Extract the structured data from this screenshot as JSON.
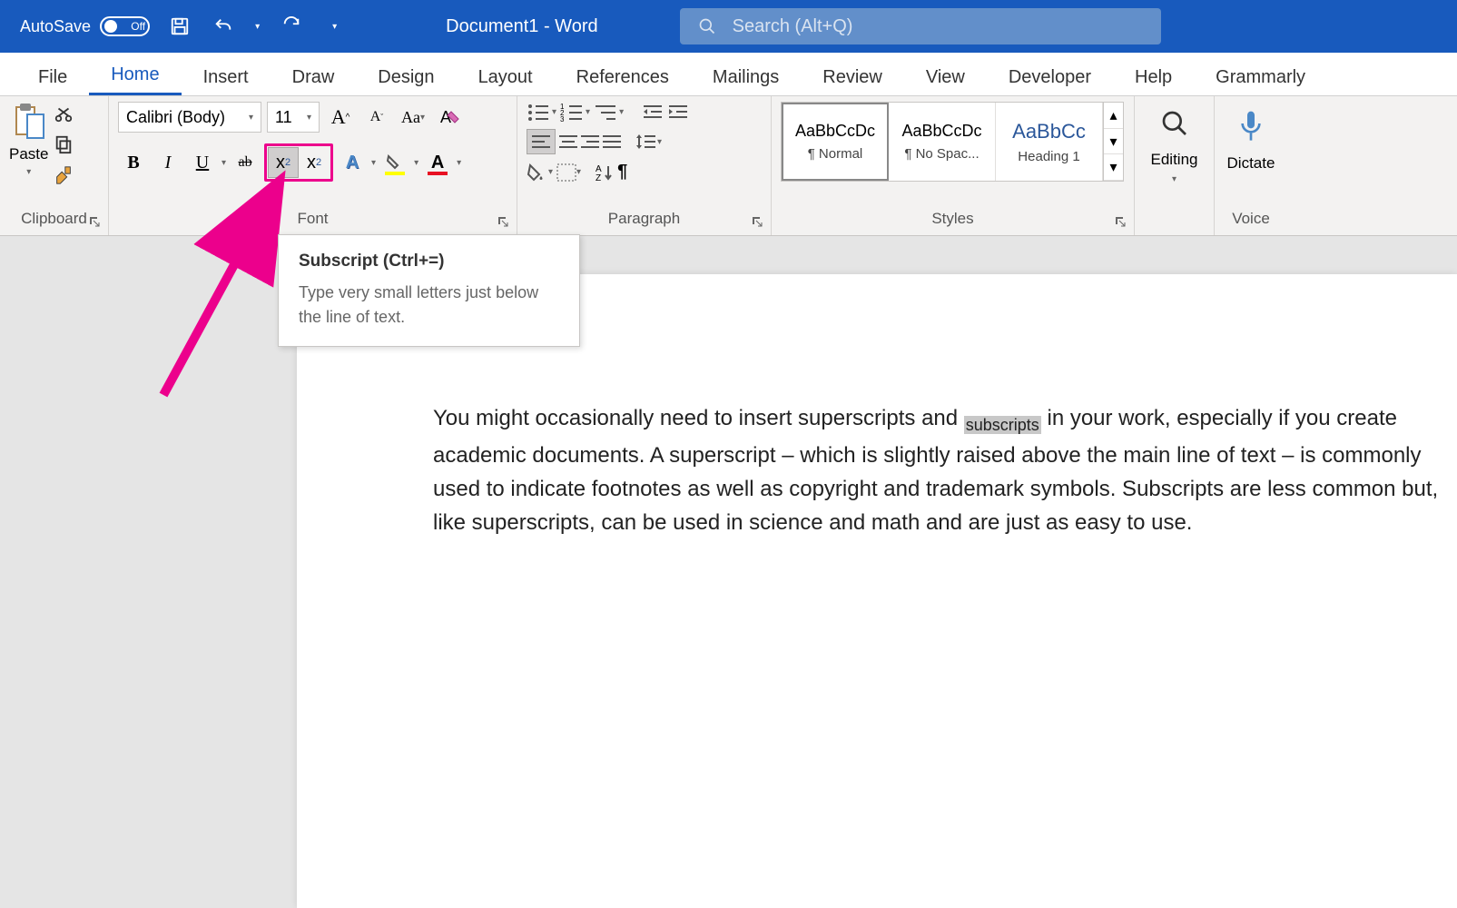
{
  "title_bar": {
    "autosave_label": "AutoSave",
    "autosave_toggle": "Off",
    "doc_title": "Document1  -  Word",
    "search_placeholder": "Search (Alt+Q)"
  },
  "tabs": [
    "File",
    "Home",
    "Insert",
    "Draw",
    "Design",
    "Layout",
    "References",
    "Mailings",
    "Review",
    "View",
    "Developer",
    "Help",
    "Grammarly"
  ],
  "active_tab": "Home",
  "clipboard": {
    "paste": "Paste",
    "label": "Clipboard"
  },
  "font": {
    "name": "Calibri (Body)",
    "size": "11",
    "bold": "B",
    "italic": "I",
    "underline": "U",
    "strike": "ab",
    "sub": "x",
    "sub2": "2",
    "sup": "x",
    "sup2": "2",
    "label": "Font"
  },
  "paragraph": {
    "label": "Paragraph"
  },
  "styles": {
    "label": "Styles",
    "items": [
      {
        "preview": "AaBbCcDc",
        "name": "¶ Normal"
      },
      {
        "preview": "AaBbCcDc",
        "name": "¶ No Spac..."
      },
      {
        "preview": "AaBbCc",
        "name": "Heading 1"
      }
    ]
  },
  "editing": {
    "label": "Editing"
  },
  "dictate": {
    "label": "Dictate"
  },
  "voice": {
    "label": "Voice"
  },
  "tooltip": {
    "title": "Subscript (Ctrl+=)",
    "body": "Type very small letters just below the line of text."
  },
  "document": {
    "line_pre": "You might occasionally need to insert superscripts and ",
    "sub_word": "subscripts",
    "line_post": " in your work, especially if you create academic documents. A superscript – which is slightly raised above the main line of text – is commonly used to indicate footnotes as well as copyright and trademark symbols. Subscripts are less common but, like superscripts, can be used in science and math and are just as easy to use."
  }
}
